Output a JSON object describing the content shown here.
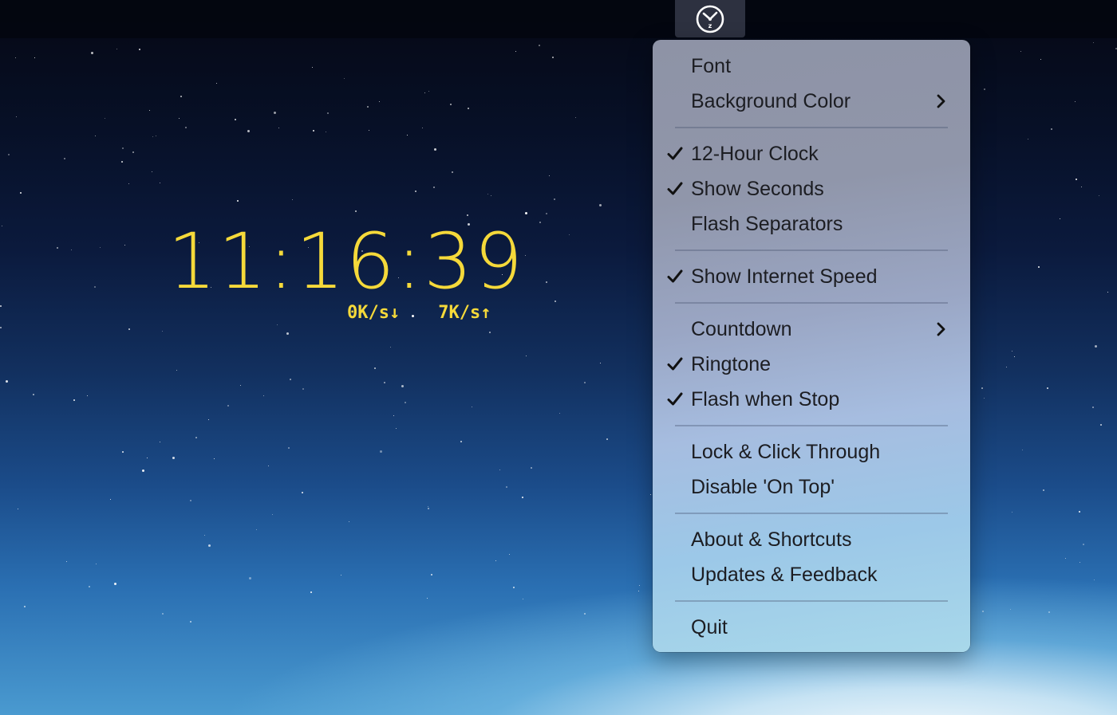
{
  "menubar": {
    "tray_icon": "clock-z-icon",
    "tray_icon_badge": "z"
  },
  "clock": {
    "time": "11:16:39",
    "download_speed": "0K/s↓",
    "upload_speed": "7K/s↑",
    "color": "#f5d93a"
  },
  "menu": {
    "groups": [
      [
        {
          "label": "Font",
          "checked": false,
          "submenu": false
        },
        {
          "label": "Background Color",
          "checked": false,
          "submenu": true
        }
      ],
      [
        {
          "label": "12-Hour Clock",
          "checked": true,
          "submenu": false
        },
        {
          "label": "Show Seconds",
          "checked": true,
          "submenu": false
        },
        {
          "label": "Flash Separators",
          "checked": false,
          "submenu": false
        }
      ],
      [
        {
          "label": "Show Internet Speed",
          "checked": true,
          "submenu": false
        }
      ],
      [
        {
          "label": "Countdown",
          "checked": false,
          "submenu": true
        },
        {
          "label": "Ringtone",
          "checked": true,
          "submenu": false
        },
        {
          "label": "Flash when Stop",
          "checked": true,
          "submenu": false
        }
      ],
      [
        {
          "label": "Lock & Click Through",
          "checked": false,
          "submenu": false
        },
        {
          "label": "Disable 'On Top'",
          "checked": false,
          "submenu": false
        }
      ],
      [
        {
          "label": "About & Shortcuts",
          "checked": false,
          "submenu": false
        },
        {
          "label": "Updates & Feedback",
          "checked": false,
          "submenu": false
        }
      ],
      [
        {
          "label": "Quit",
          "checked": false,
          "submenu": false
        }
      ]
    ]
  }
}
